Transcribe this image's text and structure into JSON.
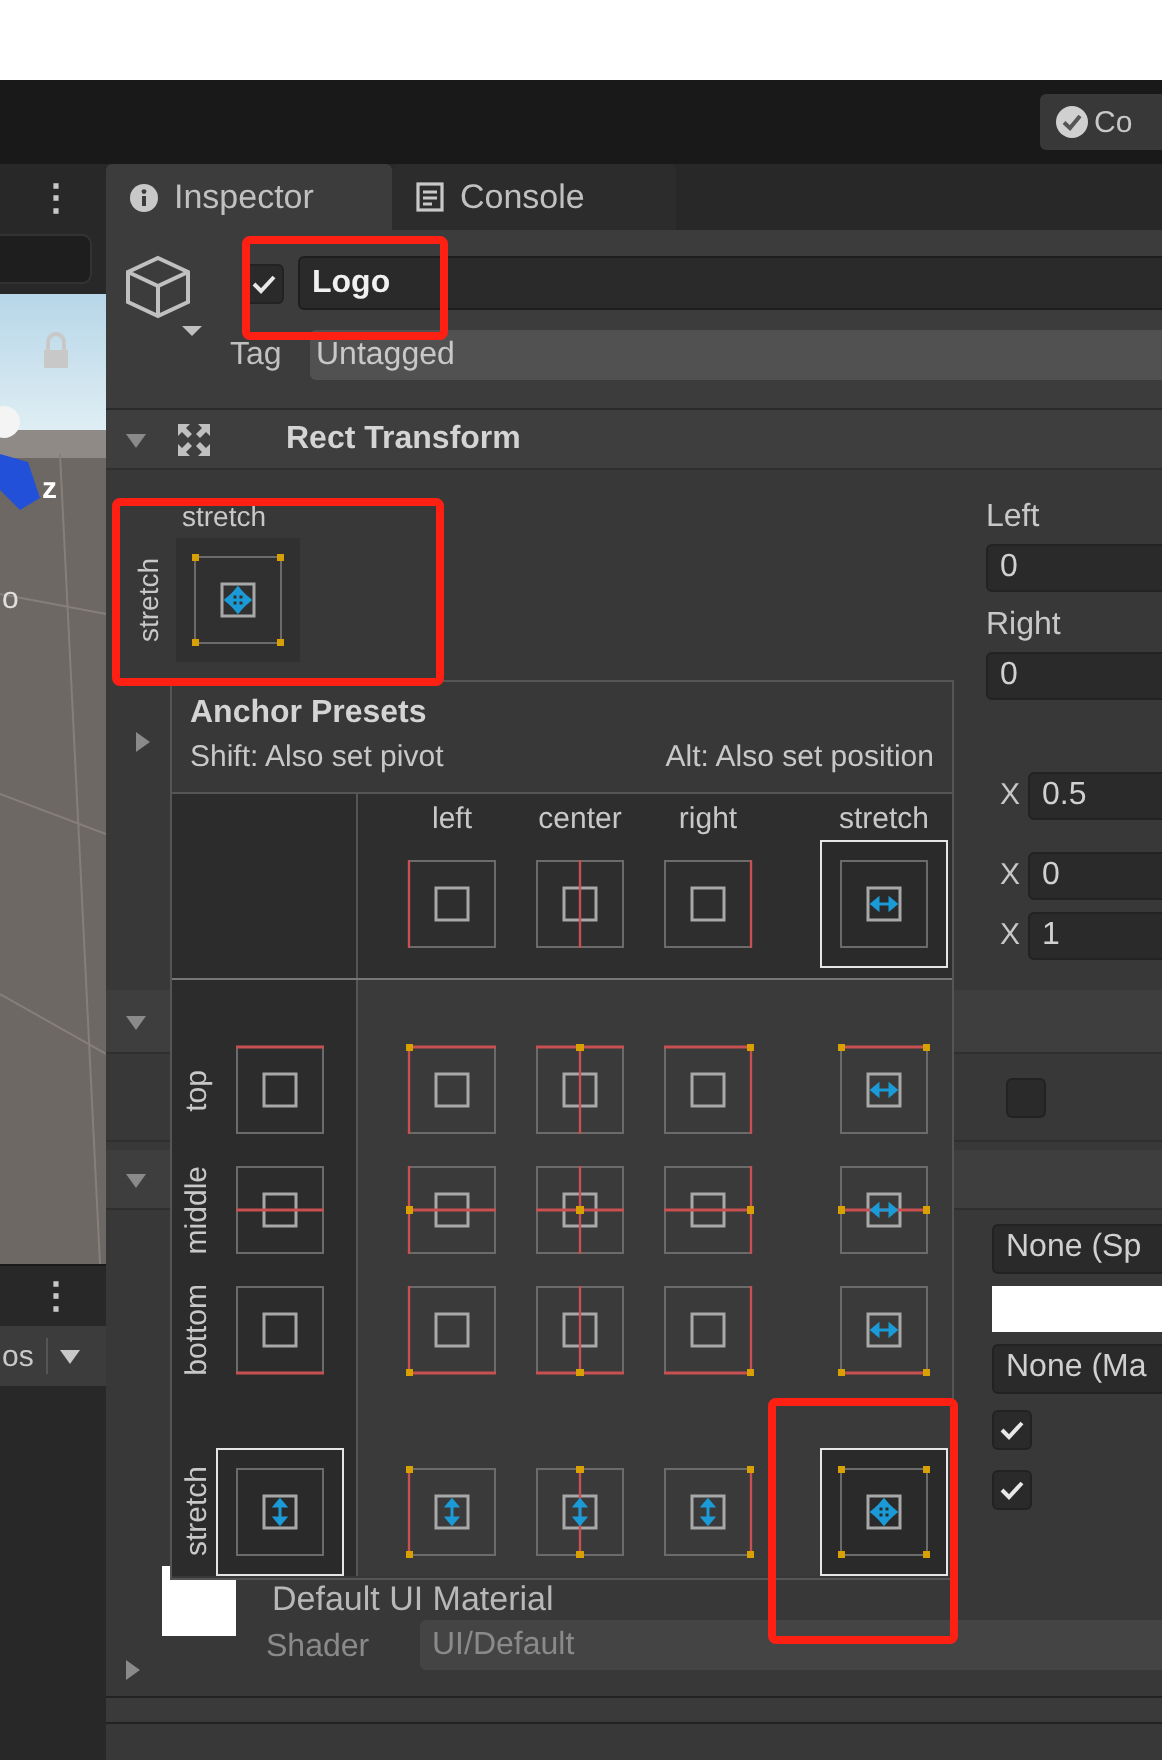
{
  "toolbar": {
    "collab_button": {
      "label": "Co"
    }
  },
  "scene_panel": {
    "menu": "⋮",
    "axis_label": "z",
    "overlay_text": "o"
  },
  "lower_panel": {
    "menu": "⋮",
    "label": "os"
  },
  "inspector": {
    "tabs": [
      {
        "label": "Inspector",
        "selected": true
      },
      {
        "label": "Console",
        "selected": false
      }
    ],
    "object": {
      "active": true,
      "name": "Logo",
      "highlighted": true,
      "tag_label": "Tag",
      "tag": "Untagged"
    },
    "rect_transform": {
      "title": "Rect Transform",
      "expanded": true,
      "anchors_expanded": false,
      "anchor": {
        "top_label": "stretch",
        "side_label": "stretch",
        "highlighted": true
      },
      "fields": [
        {
          "label": "Left",
          "value": "0"
        },
        {
          "label": "Right",
          "value": "0"
        }
      ],
      "axis_fields": [
        {
          "axis": "X",
          "value": "0.5"
        },
        {
          "axis": "X",
          "value": "0"
        },
        {
          "axis": "X",
          "value": "1"
        }
      ]
    },
    "components": [
      {
        "expanded": true,
        "fields": [
          {
            "kind": "toggle",
            "checked": false
          }
        ]
      },
      {
        "expanded": true,
        "fields": [
          {
            "kind": "object",
            "value": "None (Sp"
          },
          {
            "kind": "color",
            "color": "#ffffff"
          },
          {
            "kind": "object",
            "value": "None (Ma"
          },
          {
            "kind": "toggle",
            "checked": true
          },
          {
            "kind": "toggle",
            "checked": true
          }
        ]
      }
    ],
    "material": {
      "name": "Default UI Material",
      "expanded": false,
      "shader_label": "Shader",
      "shader": "UI/Default"
    }
  },
  "anchor_presets": {
    "title": "Anchor Presets",
    "hints": [
      "Shift: Also set pivot",
      "Alt: Also set position"
    ],
    "columns": [
      {
        "label": "left",
        "selected": false
      },
      {
        "label": "center",
        "selected": false
      },
      {
        "label": "right",
        "selected": false
      },
      {
        "label": "stretch",
        "selected": true
      }
    ],
    "rows": [
      {
        "label": "top",
        "selected": false,
        "cells": [
          {
            "selected": false,
            "highlighted": false
          },
          {
            "selected": false,
            "highlighted": false
          },
          {
            "selected": false,
            "highlighted": false
          },
          {
            "selected": false,
            "highlighted": false
          }
        ]
      },
      {
        "label": "middle",
        "selected": false,
        "cells": [
          {
            "selected": false,
            "highlighted": false
          },
          {
            "selected": false,
            "highlighted": false
          },
          {
            "selected": false,
            "highlighted": false
          },
          {
            "selected": false,
            "highlighted": false
          }
        ]
      },
      {
        "label": "bottom",
        "selected": false,
        "cells": [
          {
            "selected": false,
            "highlighted": false
          },
          {
            "selected": false,
            "highlighted": false
          },
          {
            "selected": false,
            "highlighted": false
          },
          {
            "selected": false,
            "highlighted": false
          }
        ]
      },
      {
        "label": "stretch",
        "selected": true,
        "cells": [
          {
            "selected": false,
            "highlighted": false
          },
          {
            "selected": false,
            "highlighted": false
          },
          {
            "selected": false,
            "highlighted": false
          },
          {
            "selected": true,
            "highlighted": true
          }
        ]
      }
    ]
  }
}
